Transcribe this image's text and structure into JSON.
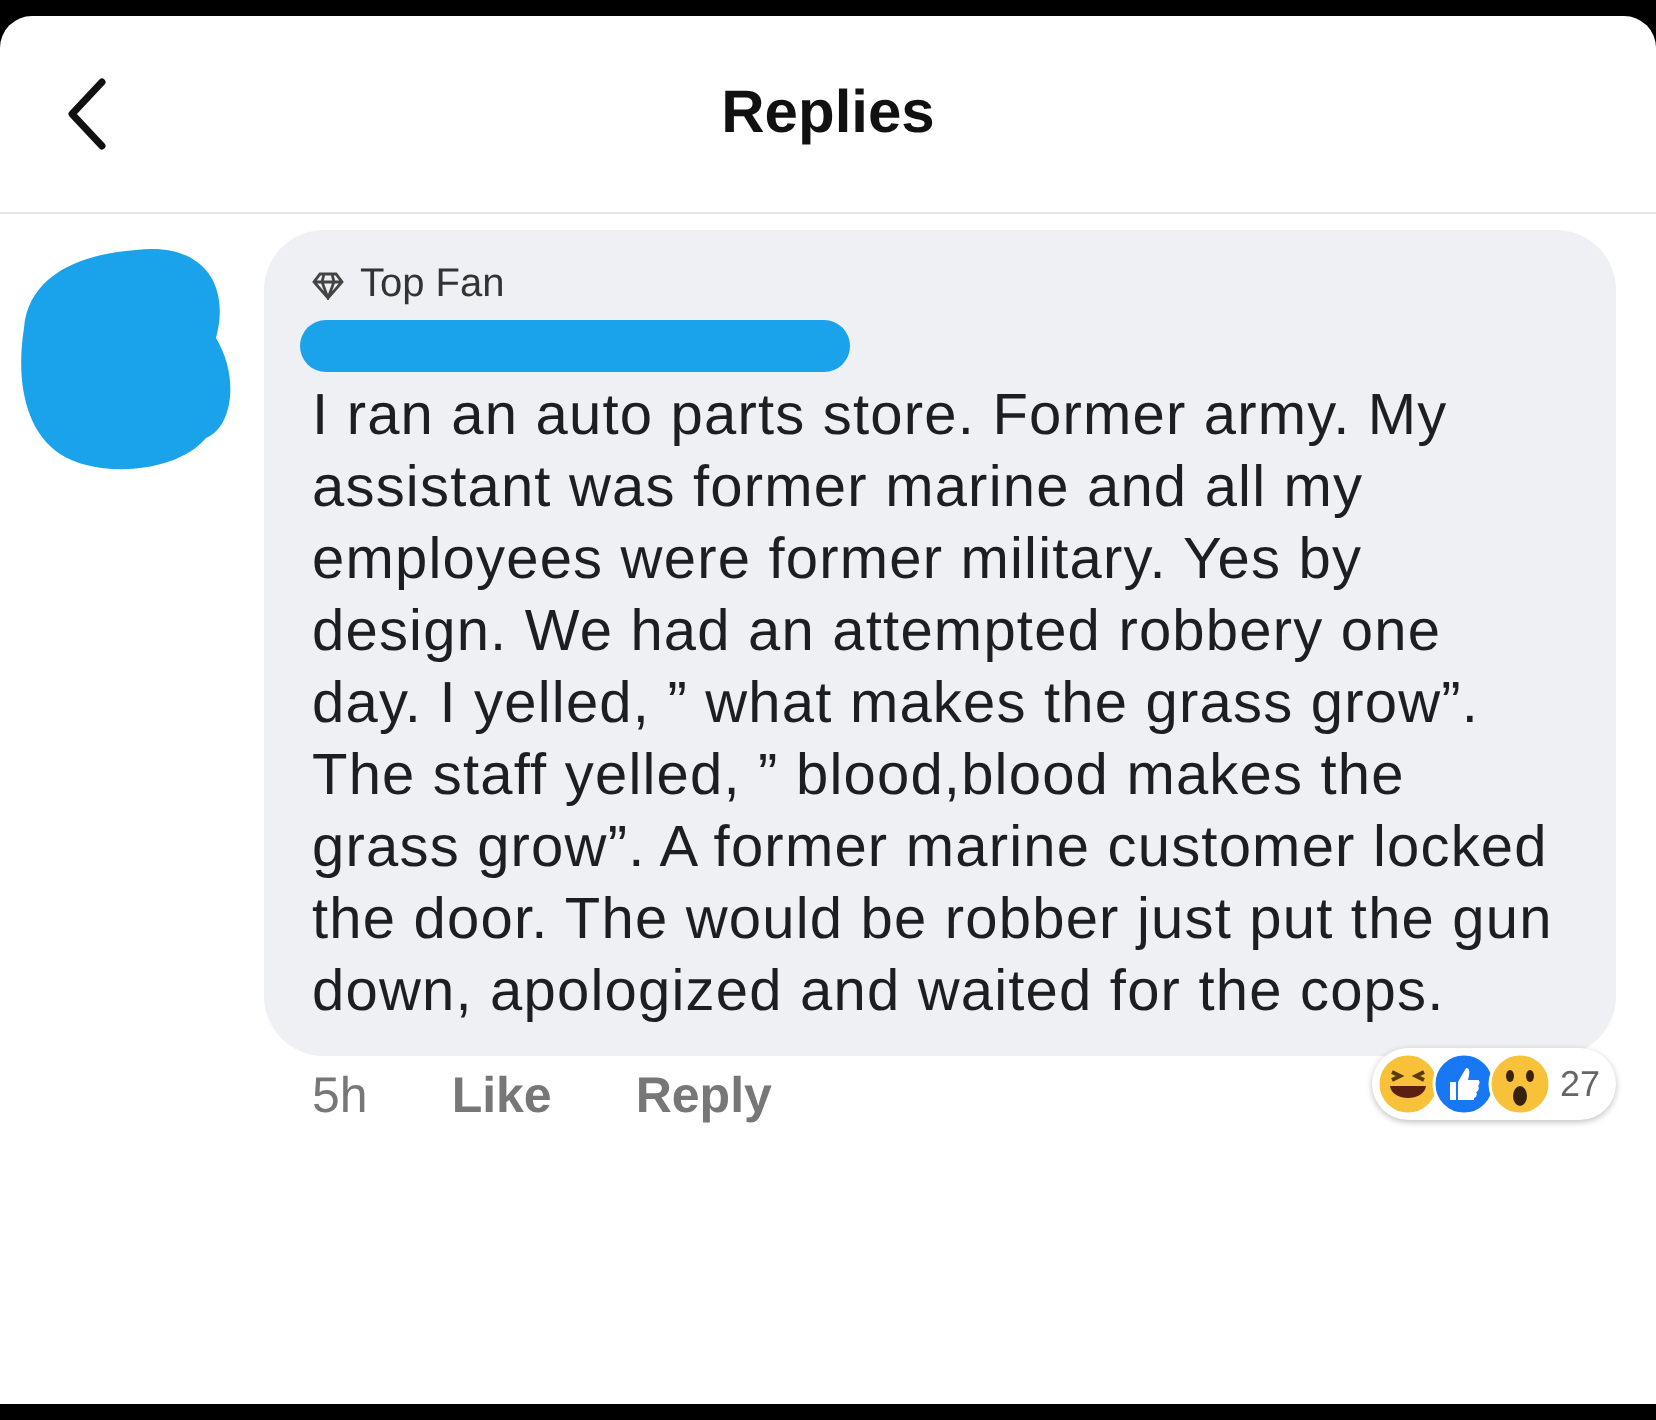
{
  "header": {
    "title": "Replies"
  },
  "comment": {
    "badge": "Top Fan",
    "author_redacted": true,
    "text": "I ran an auto parts store. Former army. My assistant was former marine and all my employees were former military. Yes by design. We had an attempted robbery one day. I yelled, ” what makes the grass grow”. The staff yelled, ” blood,blood makes the grass grow”.  A former marine customer locked the door. The would be robber just put the gun down, apologized and waited for the cops.",
    "time": "5h",
    "actions": [
      "Like",
      "Reply"
    ],
    "reactions": [
      {
        "kind": "haha"
      },
      {
        "kind": "like"
      },
      {
        "kind": "wow"
      }
    ],
    "reaction_count": "27"
  }
}
